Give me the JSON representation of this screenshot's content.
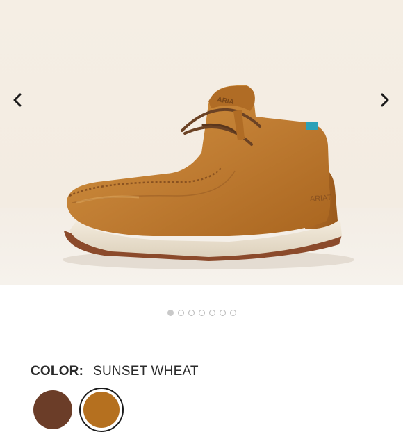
{
  "gallery": {
    "prev_icon": "chevron-left-icon",
    "next_icon": "chevron-right-icon",
    "slides": 7,
    "active_slide": 1,
    "shoe_logo_text": "ARIAT"
  },
  "color": {
    "label": "COLOR:",
    "value": "SUNSET WHEAT"
  },
  "swatches": [
    {
      "name": "dark-brown",
      "color": "#6b3d28",
      "selected": false
    },
    {
      "name": "sunset-wheat",
      "color": "#b5701f",
      "selected": true
    }
  ],
  "colors": {
    "text": "#2b2b2b",
    "dot_active": "#c9c9c9",
    "dot_border": "#b8b8b8",
    "leather": "#c07d33",
    "sole": "#ece3d2",
    "outsole": "#8b4a2b"
  }
}
